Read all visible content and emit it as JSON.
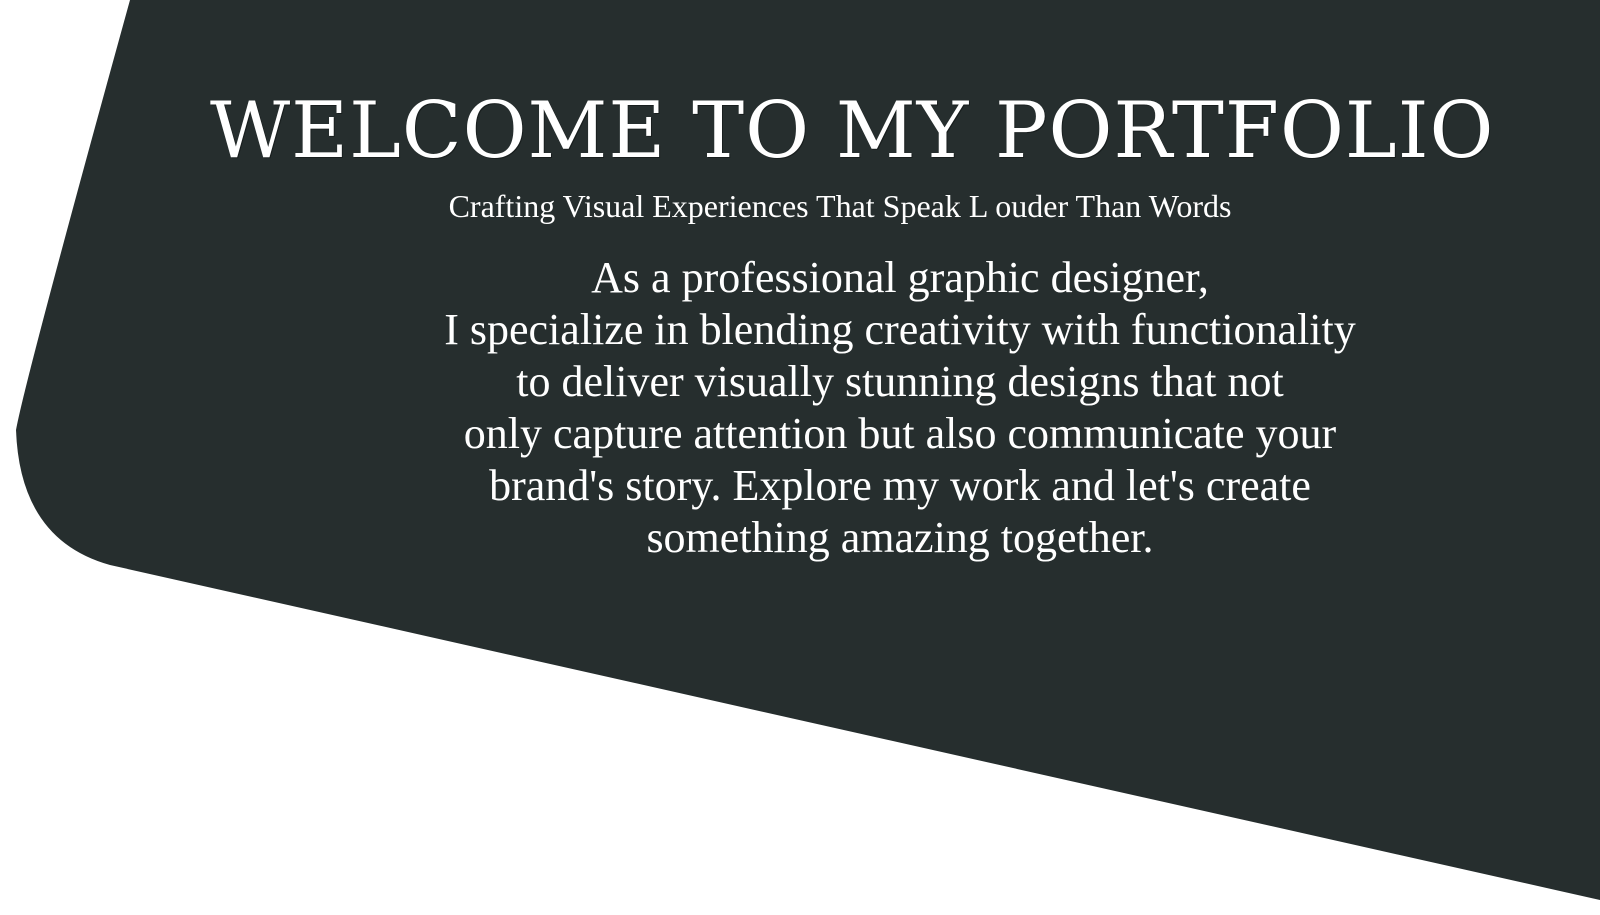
{
  "hero": {
    "title": "WELCOME TO MY PORTFOLIO",
    "subtitle": "Crafting Visual Experiences That Speak L ouder Than Words",
    "intro_lines": [
      "As a professional graphic designer,",
      "I specialize in blending creativity with functionality",
      "to deliver visually stunning designs that not",
      "only capture attention but also communicate your",
      "brand's story. Explore my work and let's create",
      "something amazing together."
    ]
  },
  "colors": {
    "background": "#ffffff",
    "panel": "#262e2e",
    "text": "#ffffff"
  }
}
